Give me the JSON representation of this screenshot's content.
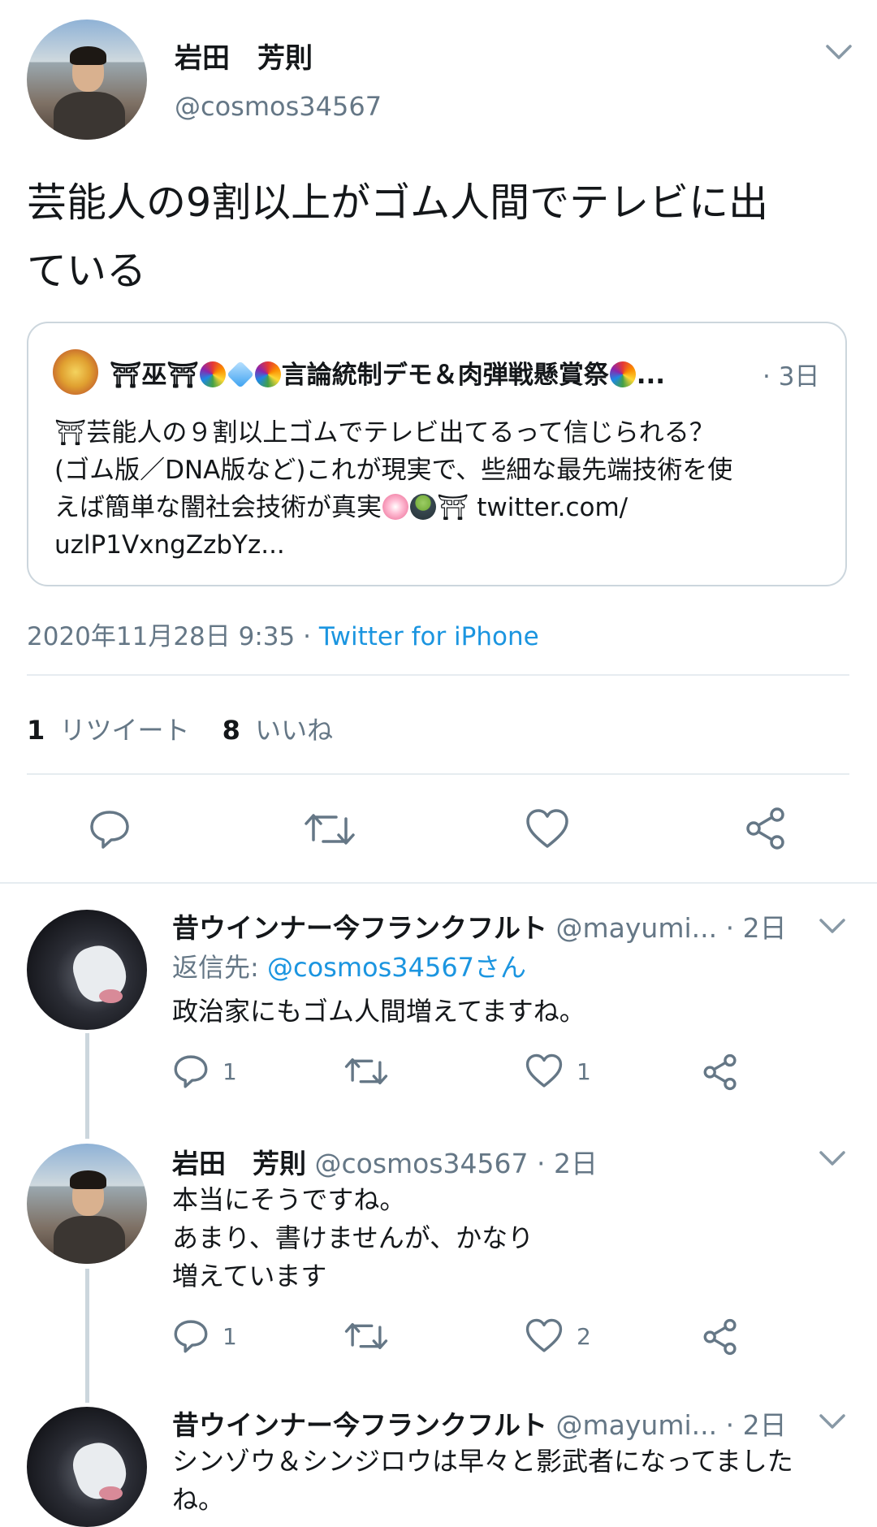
{
  "tweet": {
    "author_name": "岩田　芳則",
    "author_handle": "@cosmos34567",
    "text_line1": "芸能人の9割以上がゴム人間でテレビに出",
    "text_line2": "ている",
    "quote": {
      "author_name_part1": "⛩巫⛩",
      "author_name_part2": "言論統制デモ＆肉弾戦懸賞祭",
      "time": "· 3日",
      "line1": "⛩芸能人の９割以上ゴムでテレビ出てるって信じられる？",
      "line2": "(ゴム版／DNA版など)これが現実で、些細な最先端技術を使",
      "line3_prefix": "えば簡単な闇社会技術が真実",
      "line3_suffix": "⛩ twitter.com/",
      "line4": "uzlP1VxngZzbYz..."
    },
    "timestamp": "2020年11月28日 9:35 · ",
    "source": "Twitter for iPhone",
    "retweet_count": "1",
    "retweet_label": "リツイート",
    "like_count": "8",
    "like_label": "いいね"
  },
  "replies": [
    {
      "name": "昔ウインナー今フランクフルト",
      "handle": "@mayumi...",
      "time": "· 2日",
      "reply_to_label": "返信先: ",
      "reply_to_handle": "@cosmos34567さん",
      "text": [
        "政治家にもゴム人間増えてますね。"
      ],
      "reply_count": "1",
      "retweet_count": "",
      "like_count": "1"
    },
    {
      "name": "岩田　芳則",
      "handle": "@cosmos34567",
      "time": "· 2日",
      "text": [
        "本当にそうですね。",
        "あまり、書けませんが、かなり",
        "増えています"
      ],
      "reply_count": "1",
      "retweet_count": "",
      "like_count": "2"
    },
    {
      "name": "昔ウインナー今フランクフルト",
      "handle": "@mayumi...",
      "time": "· 2日",
      "text": [
        "シンゾウ＆シンジロウは早々と影武者になってました",
        "ね。"
      ]
    }
  ],
  "icons": {
    "chevron": "chevron-down-icon",
    "reply": "reply-icon",
    "retweet": "retweet-icon",
    "like": "like-icon",
    "share": "share-icon"
  },
  "colors": {
    "link": "#1b95e0",
    "secondary_text": "#657786",
    "divider": "#e6ecf0"
  }
}
